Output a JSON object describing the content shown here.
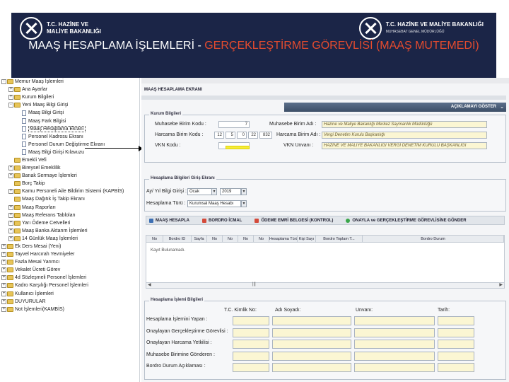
{
  "banner": {
    "title_prefix": "MAAŞ HESAPLAMA İŞLEMLERİ - ",
    "title_highlight": "GERÇEKLEŞTİRME GÖREVLİSİ (MAAŞ MUTEMEDİ)",
    "left_logo_line1": "T.C. HAZİNE VE",
    "left_logo_line2": "MALİYE BAKANLIĞI",
    "right_logo_line1": "T.C. HAZİNE VE MALİYE BAKANLIĞI",
    "right_logo_line2": "MUHASEBAT GENEL MÜDÜRLÜĞÜ"
  },
  "tree": {
    "items": [
      {
        "label": "Memur Maaş İşlemleri",
        "level": 0,
        "type": "folder",
        "exp": "-"
      },
      {
        "label": "Ana Ayarlar",
        "level": 1,
        "type": "folder",
        "exp": "+"
      },
      {
        "label": "Kurum Bilgileri",
        "level": 1,
        "type": "folder",
        "exp": "+"
      },
      {
        "label": "Yeni Maaş Bilgi Girişi",
        "level": 1,
        "type": "folder",
        "exp": "-"
      },
      {
        "label": "Maaş Bilgi Girişi",
        "level": 2,
        "type": "doc",
        "exp": ""
      },
      {
        "label": "Maaş Fark Bilgisi",
        "level": 2,
        "type": "doc",
        "exp": ""
      },
      {
        "label": "Maaş Hesaplama Ekranı",
        "level": 2,
        "type": "doc",
        "exp": "",
        "selected": true
      },
      {
        "label": "Personel Kadrosu Ekranı",
        "level": 2,
        "type": "doc",
        "exp": ""
      },
      {
        "label": "Personel Durum Değiştirme Ekranı",
        "level": 2,
        "type": "doc",
        "exp": ""
      },
      {
        "label": "Maaş Bilgi Girişi Kılavuzu",
        "level": 2,
        "type": "doc",
        "exp": ""
      },
      {
        "label": "Emekli Vefi",
        "level": 1,
        "type": "folder",
        "exp": ""
      },
      {
        "label": "Bireysel Emeklilik",
        "level": 1,
        "type": "folder",
        "exp": "+"
      },
      {
        "label": "Banak Sermaye İşlemleri",
        "level": 1,
        "type": "folder",
        "exp": "+"
      },
      {
        "label": "Borç Takip",
        "level": 1,
        "type": "folder",
        "exp": ""
      },
      {
        "label": "Kamu Personeli Aile Bildirim Sistemi (KAPBİS)",
        "level": 1,
        "type": "folder",
        "exp": "+"
      },
      {
        "label": "Maaş Dağıtık İş Takip Ekranı",
        "level": 1,
        "type": "folder",
        "exp": ""
      },
      {
        "label": "Maaş Raporları",
        "level": 1,
        "type": "folder",
        "exp": "+"
      },
      {
        "label": "Maaş Referans Tabloları",
        "level": 1,
        "type": "folder",
        "exp": "+"
      },
      {
        "label": "Yarı Ödeme Cetvelleri",
        "level": 1,
        "type": "folder",
        "exp": "+"
      },
      {
        "label": "Maaş Banka Aktarım İşlemleri",
        "level": 1,
        "type": "folder",
        "exp": "+"
      },
      {
        "label": "14 Günlük Maaş İşlemleri",
        "level": 1,
        "type": "folder",
        "exp": "+"
      },
      {
        "label": "Ek Ders Mesai (Yeni)",
        "level": 0,
        "type": "folder",
        "exp": "+"
      },
      {
        "label": "Tayvel Harcırah Yevmiyeler",
        "level": 0,
        "type": "folder",
        "exp": "+"
      },
      {
        "label": "Fazla Mesai Yarımcı",
        "level": 0,
        "type": "folder",
        "exp": "+"
      },
      {
        "label": "Vekalet Ücreti Görev",
        "level": 0,
        "type": "folder",
        "exp": "+"
      },
      {
        "label": "4d Sözleşmeli Personel İşlemleri",
        "level": 0,
        "type": "folder",
        "exp": "+"
      },
      {
        "label": "Kadro Karşılığı Personel İşlemleri",
        "level": 0,
        "type": "folder",
        "exp": "+"
      },
      {
        "label": "Kullanıcı İşlemleri",
        "level": 0,
        "type": "folder",
        "exp": "+"
      },
      {
        "label": "DUYURULAR",
        "level": 0,
        "type": "folder",
        "exp": "+"
      },
      {
        "label": "Not İşlemleri(KAMBİS)",
        "level": 0,
        "type": "folder",
        "exp": "+"
      }
    ]
  },
  "screen": {
    "title": "MAAŞ HESAPLAMA EKRANI",
    "show_button": "AÇIKLAMAYI GÖSTER",
    "institution": {
      "legend": "Kurum Bilgileri",
      "muhasebe_kod_label": "Muhasebe Birim Kodu :",
      "muhasebe_kod_value": "7",
      "muhasebe_ad_label": "Muhasebe Birim Adı :",
      "muhasebe_ad_value": "Hazine ve Maliye Bakanlığı Merkez Saymanlık Müdürlüğü",
      "harcama_kod_label": "Harcama Birim Kodu :",
      "harcama_kod_parts": [
        "12",
        "5",
        "0",
        "22",
        "832"
      ],
      "harcama_ad_label": "Harcama Birim Adı :",
      "harcama_ad_value": "Vergi Denetim Kurulu Başkanlığı",
      "vkn_label": "VKN Kodu :",
      "vkn_unvan_label": "VKN Unvanı :",
      "vkn_unvan_value": "HAZİNE VE MALİYE BAKANLIĞI VERGİ DENETİM KURULU BAŞKANLIĞI"
    },
    "calc": {
      "legend": "Hesaplama Bilgileri Giriş Ekranı",
      "period_label": "Ay/ Yıl Bilgi Girişi :",
      "month_value": "Ocak",
      "year_value": "2019",
      "type_label": "Hesaplama Türü :",
      "type_value": "Kurumsal Maaş Hesabı"
    },
    "toolbar": {
      "item1": "MAAŞ HESAPLA",
      "item2": "BORDRO İCMAL",
      "item3": "ÖDEME EMRİ BELGESİ (KONTROL)",
      "item4": "ONAYLA ve GERÇEKLEŞTİRME GÖREVLİSİNE GÖNDER"
    },
    "grid": {
      "columns": [
        "No",
        "Bordro ID",
        "Sayfa",
        "No",
        "No",
        "No",
        "No",
        "Hesaplama Türü",
        "Kişi Sayı",
        "Bordro Toplam T...",
        "Bordro Durum"
      ],
      "empty_text": "Kayıt Bulunamadı."
    },
    "person": {
      "legend": "Hesaplama İşlemi Bilgileri",
      "col_tc": "T.C. Kimlik No:",
      "col_name": "Adı Soyadı:",
      "col_title": "Unvanı:",
      "col_date": "Tarih:",
      "rows": [
        "Hesaplama İşlemini Yapan :",
        "Onaylayan Gerçekleştirme Görevlisi :",
        "Onaylayan Harcama Yetkilisi :",
        "Muhasebe Birimine Gönderen :",
        "Bordro Durum Açıklaması :"
      ]
    }
  }
}
